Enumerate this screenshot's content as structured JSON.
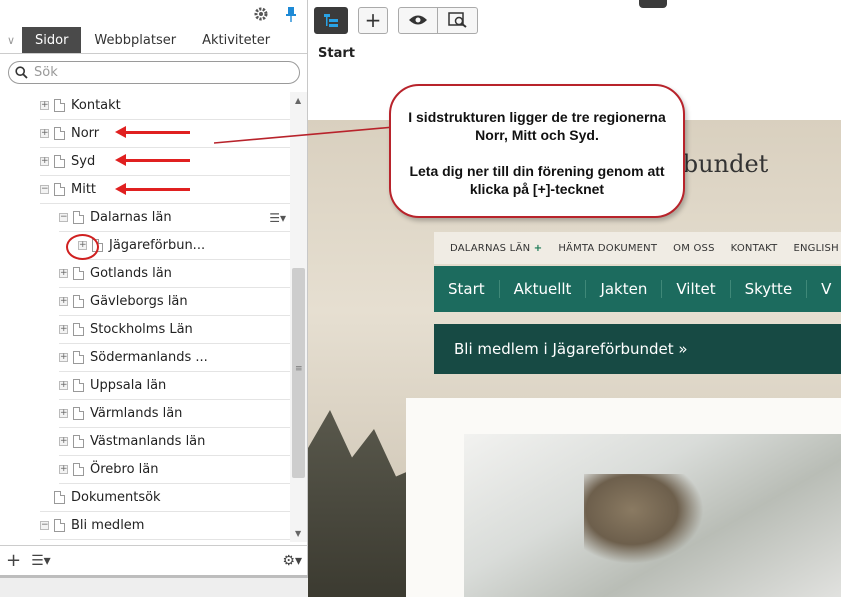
{
  "panel": {
    "tabs": [
      {
        "label": "Sidor"
      },
      {
        "label": "Webbplatser"
      },
      {
        "label": "Aktiviteter"
      }
    ],
    "search_placeholder": "Sök"
  },
  "tree": {
    "items": [
      {
        "label": "Kontakt"
      },
      {
        "label": "Norr"
      },
      {
        "label": "Syd"
      },
      {
        "label": "Mitt"
      },
      {
        "label": "Dalarnas län"
      },
      {
        "label": "Jägareförbun..."
      },
      {
        "label": "Gotlands län"
      },
      {
        "label": "Gävleborgs län"
      },
      {
        "label": "Stockholms Län"
      },
      {
        "label": "Södermanlands ..."
      },
      {
        "label": "Uppsala län"
      },
      {
        "label": "Värmlands län"
      },
      {
        "label": "Västmanlands län"
      },
      {
        "label": "Örebro län"
      },
      {
        "label": "Dokumentsök"
      },
      {
        "label": "Bli medlem"
      }
    ]
  },
  "breadcrumb": "Start",
  "preview": {
    "site_title": "förbundet",
    "top_nav": [
      "DALARNAS LÄN",
      "HÄMTA DOKUMENT",
      "OM OSS",
      "KONTAKT",
      "ENGLISH"
    ],
    "main_nav": [
      "Start",
      "Aktuellt",
      "Jakten",
      "Viltet",
      "Skytte",
      "V"
    ],
    "banner": "Bli medlem i Jägareförbundet »"
  },
  "callout": {
    "line1": "I sidstrukturen ligger de tre regionerna Norr, Mitt och Syd.",
    "line2": "Leta dig ner till din förening genom att klicka på [+]-tecknet"
  },
  "colors": {
    "accent": "#1e8ad6",
    "annotation_red": "#e02020",
    "nav_green": "#1c6b5e",
    "banner_green": "#174a44"
  }
}
